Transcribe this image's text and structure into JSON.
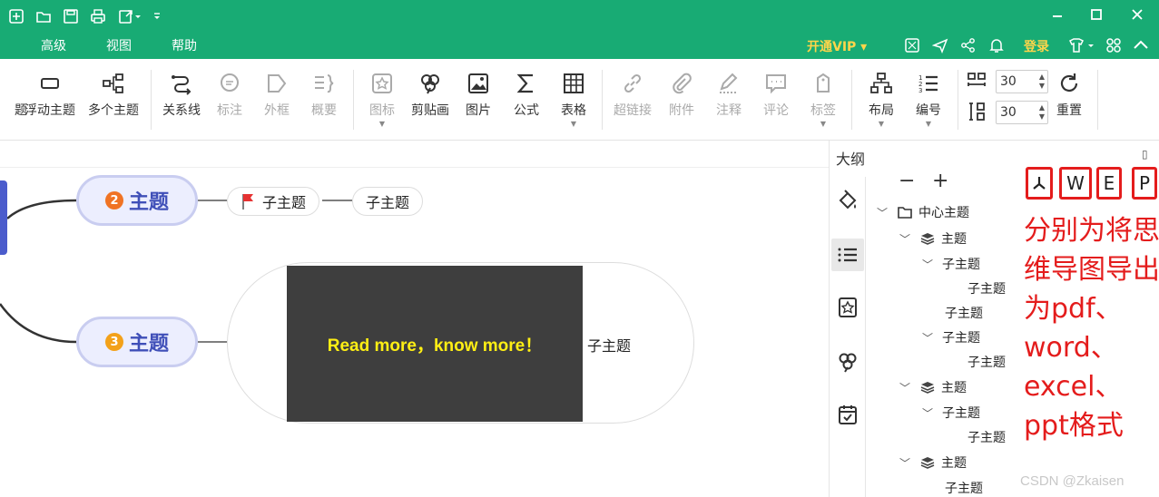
{
  "menu": {
    "items": [
      "高级",
      "视图",
      "帮助"
    ],
    "vip": "开通VIP ▾",
    "login": "登录"
  },
  "ribbon": {
    "buttons": [
      {
        "label": "题",
        "disabled": false
      },
      {
        "label": "浮动主题",
        "disabled": false
      },
      {
        "label": "多个主题",
        "disabled": false
      },
      {
        "label": "关系线",
        "disabled": false
      },
      {
        "label": "标注",
        "disabled": true
      },
      {
        "label": "外框",
        "disabled": true
      },
      {
        "label": "概要",
        "disabled": true
      },
      {
        "label": "图标",
        "disabled": true
      },
      {
        "label": "剪贴画",
        "disabled": false
      },
      {
        "label": "图片",
        "disabled": false
      },
      {
        "label": "公式",
        "disabled": false
      },
      {
        "label": "表格",
        "disabled": false
      },
      {
        "label": "超链接",
        "disabled": true
      },
      {
        "label": "附件",
        "disabled": true
      },
      {
        "label": "注释",
        "disabled": true
      },
      {
        "label": "评论",
        "disabled": true
      },
      {
        "label": "标签",
        "disabled": true
      },
      {
        "label": "布局",
        "disabled": false
      },
      {
        "label": "编号",
        "disabled": false
      },
      {
        "label": "重置",
        "disabled": false
      }
    ],
    "spacing_h": "30",
    "spacing_v": "30"
  },
  "canvas": {
    "topic2": {
      "num": "2",
      "label": "主题"
    },
    "topic3": {
      "num": "3",
      "label": "主题"
    },
    "sub1": "子主题",
    "sub2": "子主题",
    "img_text": "Read more，know more！",
    "img_sub": "子主题"
  },
  "panel": {
    "title": "大纲",
    "minus": "−",
    "plus": "+",
    "export": [
      "W",
      "E",
      "P"
    ],
    "tree": [
      {
        "label": "中心主题"
      },
      {
        "label": "主题"
      },
      {
        "label": "子主题"
      },
      {
        "label": "子主题"
      },
      {
        "label": "子主题"
      },
      {
        "label": "子主题"
      },
      {
        "label": "子主题"
      },
      {
        "label": "主题"
      },
      {
        "label": "子主题"
      },
      {
        "label": "子主题"
      },
      {
        "label": "主题"
      },
      {
        "label": "子主题"
      }
    ]
  },
  "annotation": "分别为将思维导图导出为pdf、word、excel、ppt格式",
  "watermark": "CSDN @Zkaisen",
  "colors": {
    "brand": "#18ab74",
    "accent_red": "#e41c1c",
    "vip_gold": "#ffd54a"
  }
}
